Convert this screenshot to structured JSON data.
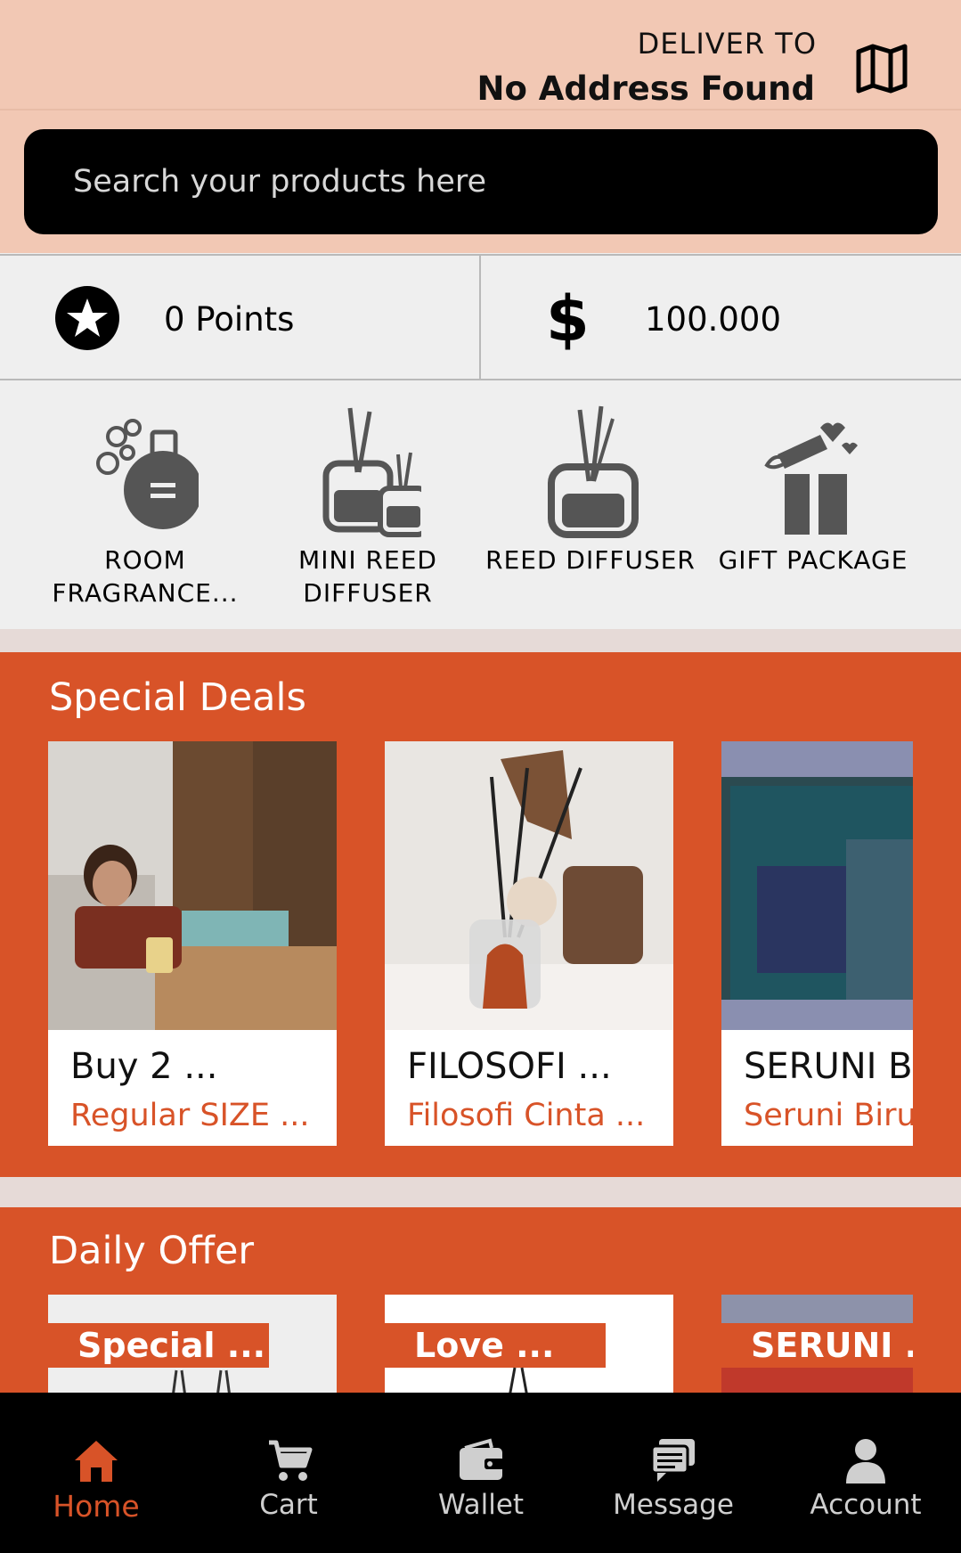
{
  "header": {
    "deliver_label": "DELIVER TO",
    "address": "No Address Found",
    "map_icon": "map-icon"
  },
  "search": {
    "placeholder": "Search your products here"
  },
  "stats": {
    "points": "0 Points",
    "balance": "100.000",
    "points_icon": "star-icon",
    "balance_icon": "dollar-icon"
  },
  "categories": [
    {
      "label": "ROOM FRAGRANCE...",
      "icon": "perfume-bottle-icon"
    },
    {
      "label": "MINI REED DIFFUSER",
      "icon": "mini-reed-diffuser-icon"
    },
    {
      "label": "REED DIFFUSER",
      "icon": "reed-diffuser-icon"
    },
    {
      "label": "GIFT PACKAGE",
      "icon": "gift-box-icon"
    }
  ],
  "special_deals": {
    "title": "Special Deals",
    "items": [
      {
        "title": "Buy 2 ...",
        "subtitle": "Regular SIZE  ..."
      },
      {
        "title": "FILOSOFI ...",
        "subtitle": "Filosofi Cinta ..."
      },
      {
        "title": "SERUNI B",
        "subtitle": "Seruni Biru"
      }
    ]
  },
  "daily_offer": {
    "title": "Daily Offer",
    "items": [
      {
        "tag": "Special ..."
      },
      {
        "tag": "Love ..."
      },
      {
        "tag": "SERUNI ..."
      }
    ]
  },
  "nav": {
    "items": [
      {
        "label": "Home",
        "icon": "home-icon",
        "active": true
      },
      {
        "label": "Cart",
        "icon": "cart-icon"
      },
      {
        "label": "Wallet",
        "icon": "wallet-icon"
      },
      {
        "label": "Message",
        "icon": "message-icon"
      },
      {
        "label": "Account",
        "icon": "account-icon"
      }
    ]
  },
  "colors": {
    "header_bg": "#f2c8b4",
    "accent": "#d85328",
    "nav_bg": "#000000"
  }
}
